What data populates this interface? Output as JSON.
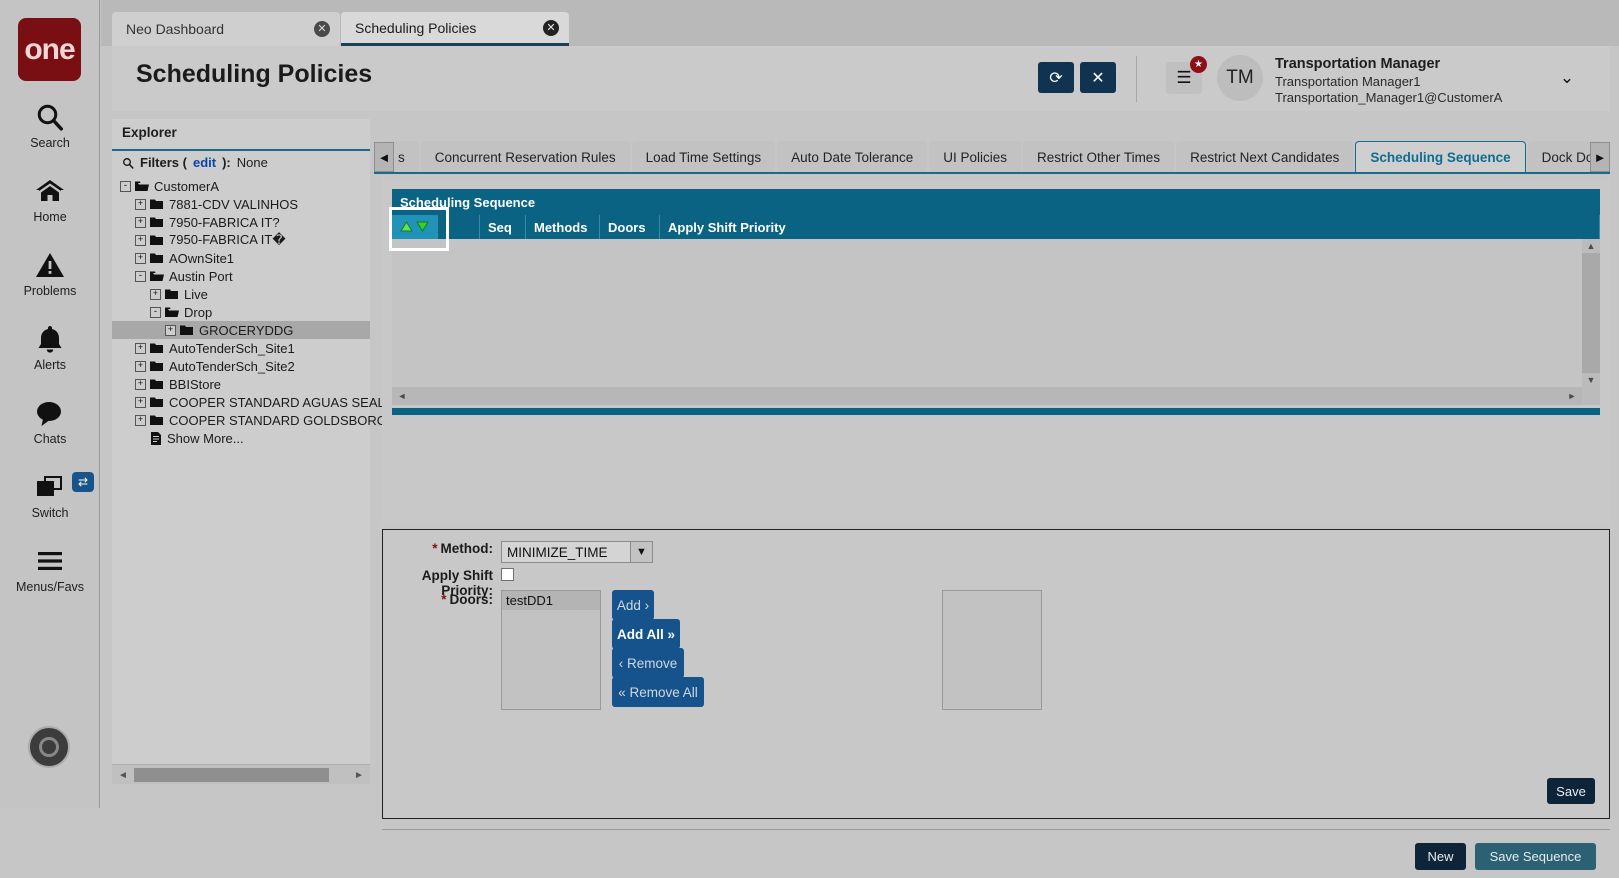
{
  "left_rail": {
    "logo_text": "one",
    "items": [
      {
        "label": "Search",
        "icon": "search-icon"
      },
      {
        "label": "Home",
        "icon": "home-icon"
      },
      {
        "label": "Problems",
        "icon": "warning-icon"
      },
      {
        "label": "Alerts",
        "icon": "bell-icon"
      },
      {
        "label": "Chats",
        "icon": "chat-icon"
      },
      {
        "label": "Switch",
        "icon": "windows-icon"
      },
      {
        "label": "Menus/Favs",
        "icon": "hamburger-icon"
      }
    ],
    "switch_badge": "⇄"
  },
  "browser_tabs": [
    {
      "label": "Neo Dashboard",
      "active": false,
      "close": "✕"
    },
    {
      "label": "Scheduling Policies",
      "active": true,
      "close": "✕"
    }
  ],
  "header": {
    "title": "Scheduling Policies",
    "refresh_icon": "⟳",
    "close_icon": "✕",
    "menu_icon": "☰",
    "menu_badge": "★",
    "avatar_initials": "TM",
    "user_name": "Transportation Manager",
    "user_login": "Transportation Manager1",
    "user_email": "Transportation_Manager1@CustomerA",
    "caret_icon": "⌄"
  },
  "explorer": {
    "title": "Explorer",
    "search_icon": "search-icon",
    "filters_label": "Filters (",
    "filters_edit": "edit",
    "filters_suffix": "):",
    "filters_value": "None",
    "tree": [
      {
        "label": "CustomerA",
        "depth": 0,
        "expander": "-",
        "open": true,
        "selected": false
      },
      {
        "label": "7881-CDV VALINHOS",
        "depth": 1,
        "expander": "+",
        "open": false,
        "selected": false
      },
      {
        "label": "7950-FABRICA IT?",
        "depth": 1,
        "expander": "+",
        "open": false,
        "selected": false
      },
      {
        "label": "7950-FABRICA IT�",
        "depth": 1,
        "expander": "+",
        "open": false,
        "selected": false
      },
      {
        "label": "AOwnSite1",
        "depth": 1,
        "expander": "+",
        "open": false,
        "selected": false
      },
      {
        "label": "Austin Port",
        "depth": 1,
        "expander": "-",
        "open": true,
        "selected": false
      },
      {
        "label": "Live",
        "depth": 2,
        "expander": "+",
        "open": false,
        "selected": false
      },
      {
        "label": "Drop",
        "depth": 2,
        "expander": "-",
        "open": true,
        "selected": false
      },
      {
        "label": "GROCERYDDG",
        "depth": 3,
        "expander": "+",
        "open": false,
        "selected": true
      },
      {
        "label": "AutoTenderSch_Site1",
        "depth": 1,
        "expander": "+",
        "open": false,
        "selected": false
      },
      {
        "label": "AutoTenderSch_Site2",
        "depth": 1,
        "expander": "+",
        "open": false,
        "selected": false
      },
      {
        "label": "BBIStore",
        "depth": 1,
        "expander": "+",
        "open": false,
        "selected": false
      },
      {
        "label": "COOPER STANDARD AGUAS SEALING (",
        "depth": 1,
        "expander": "+",
        "open": false,
        "selected": false
      },
      {
        "label": "COOPER STANDARD GOLDSBORO",
        "depth": 1,
        "expander": "+",
        "open": false,
        "selected": false
      },
      {
        "label": "Show More...",
        "depth": 1,
        "expander": "",
        "open": false,
        "selected": false,
        "doc": true
      }
    ]
  },
  "main": {
    "tab_scroll_left": "◄",
    "tab_scroll_right": "►",
    "tabs": [
      {
        "label": "s",
        "active": false
      },
      {
        "label": "Concurrent Reservation Rules",
        "active": false
      },
      {
        "label": "Load Time Settings",
        "active": false
      },
      {
        "label": "Auto Date Tolerance",
        "active": false
      },
      {
        "label": "UI Policies",
        "active": false
      },
      {
        "label": "Restrict Other Times",
        "active": false
      },
      {
        "label": "Restrict Next Candidates",
        "active": false
      },
      {
        "label": "Scheduling Sequence",
        "active": true
      },
      {
        "label": "Dock Door Sequen",
        "active": false
      }
    ],
    "grid": {
      "title": "Scheduling Sequence",
      "sort_up": "▲",
      "sort_down": "▼",
      "columns": [
        "",
        "",
        "Seq",
        "Methods",
        "Doors",
        "Apply Shift Priority"
      ],
      "rows": [],
      "vscroll_up": "▲",
      "vscroll_down": "▼",
      "hscroll_left": "◄",
      "hscroll_right": "►"
    },
    "form": {
      "method_label": "Method:",
      "method_value": "MINIMIZE_TIME",
      "method_caret": "▼",
      "priority_label": "Apply Shift Priority:",
      "priority_checked": false,
      "doors_label": "Doors:",
      "doors_available": [
        "testDD1"
      ],
      "doors_selected": [],
      "btn_add": "Add ›",
      "btn_add_all": "Add All »",
      "btn_remove": "‹ Remove",
      "btn_remove_all": "« Remove All",
      "save_label": "Save",
      "required_marker": "*"
    },
    "footer": {
      "new_label": "New",
      "save_sequence_label": "Save Sequence"
    }
  },
  "colors": {
    "brand_red": "#7a0f13",
    "teal_header": "#0a6382",
    "accent_blue": "#16528c",
    "dark_navy": "#0d2439",
    "active_tab_text": "#0e6e92",
    "link_blue": "#0b45a8"
  }
}
